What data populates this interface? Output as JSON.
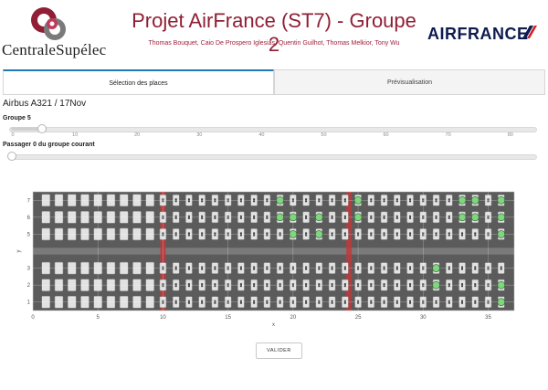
{
  "header": {
    "logo_text": "CentraleSupélec",
    "title": "Projet AirFrance (ST7) - Groupe 2",
    "authors": "Thomas Bouquet, Caio De Prospero Iglesias, Quentin Guilhot, Thomas Melkior, Tony Wu",
    "airline_logo": "AIRFRANCE"
  },
  "tabs": [
    {
      "label": "Sélection des places",
      "active": true
    },
    {
      "label": "Prévisualisation",
      "active": false
    }
  ],
  "main": {
    "plane_title": "Airbus A321 / 17Nov",
    "group_slider": {
      "label": "Groupe 5",
      "value": 5,
      "min": 0,
      "max": 84,
      "ticks": [
        "0",
        "10",
        "20",
        "30",
        "40",
        "50",
        "60",
        "70",
        "80"
      ]
    },
    "passenger_slider": {
      "label": "Passager 0 du groupe courant",
      "value": 0
    },
    "validate_label": "VALIDER"
  },
  "chart_data": {
    "type": "scatter",
    "xlabel": "x",
    "ylabel": "y",
    "xlim": [
      0,
      37
    ],
    "ylim": [
      0.5,
      7.5
    ],
    "x_ticks": [
      0,
      5,
      10,
      15,
      20,
      25,
      30,
      35
    ],
    "y_ticks": [
      1,
      2,
      3,
      5,
      6,
      7
    ],
    "series": [
      {
        "marker_color": "#7ed67e",
        "points": [
          [
            19,
            7
          ],
          [
            19,
            6
          ],
          [
            20,
            6
          ],
          [
            22,
            6
          ],
          [
            20,
            5
          ],
          [
            22,
            5
          ],
          [
            25,
            7
          ],
          [
            25,
            6
          ],
          [
            33,
            7
          ],
          [
            34,
            7
          ],
          [
            33,
            6
          ],
          [
            34,
            6
          ],
          [
            36,
            6
          ],
          [
            36,
            7
          ],
          [
            36,
            5
          ],
          [
            31,
            3
          ],
          [
            31,
            2
          ],
          [
            36,
            2
          ],
          [
            36,
            1
          ]
        ]
      }
    ],
    "background_image": "aircraft-cabin-seat-map"
  }
}
